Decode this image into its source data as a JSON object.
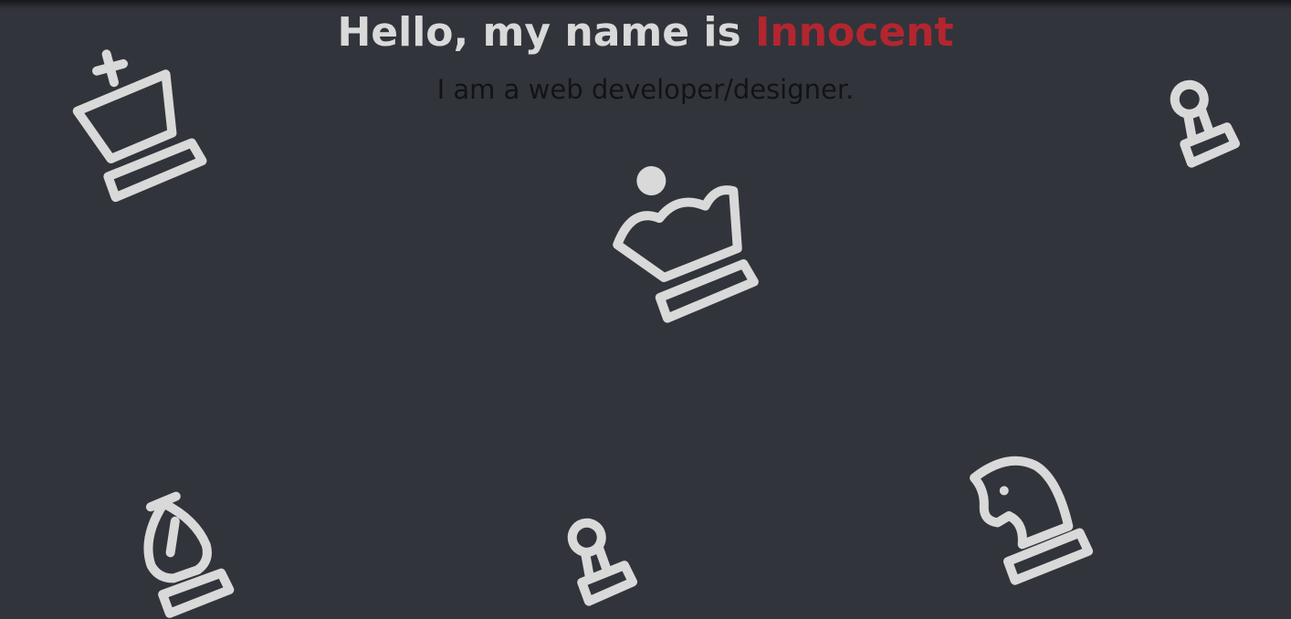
{
  "hero": {
    "greeting": "Hello, my name is ",
    "name": "Innocent",
    "subtitle": "I am a web developer/designer."
  },
  "colors": {
    "background": "#32343b",
    "title": "#d9d9d9",
    "name_accent": "#b3262f",
    "subtitle": "#121315",
    "pieces": "#d9d9d9"
  },
  "background_pieces": [
    "king-icon",
    "queen-icon",
    "pawn-icon",
    "bishop-icon",
    "pawn-icon",
    "knight-icon"
  ]
}
